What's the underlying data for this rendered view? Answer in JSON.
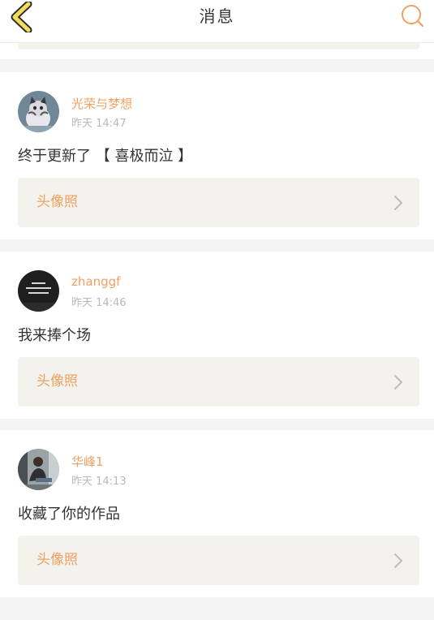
{
  "header": {
    "title": "消息",
    "back_icon": "chevron-left-icon",
    "search_icon": "search-icon"
  },
  "colors": {
    "accent": "#f0a062",
    "back_icon_fill": "#f2dc5d",
    "card_ref_bg": "#f3f2ec",
    "page_bg": "#f4f4f4"
  },
  "messages": [
    {
      "username": "光荣与梦想",
      "time": "昨天 14:47",
      "text": "终于更新了 【 喜极而泣 】",
      "ref_title": "头像照"
    },
    {
      "username": "zhanggf",
      "time": "昨天 14:46",
      "text": "我来捧个场",
      "ref_title": "头像照"
    },
    {
      "username": "华峰1",
      "time": "昨天 14:13",
      "text": "收藏了你的作品",
      "ref_title": "头像照"
    }
  ]
}
